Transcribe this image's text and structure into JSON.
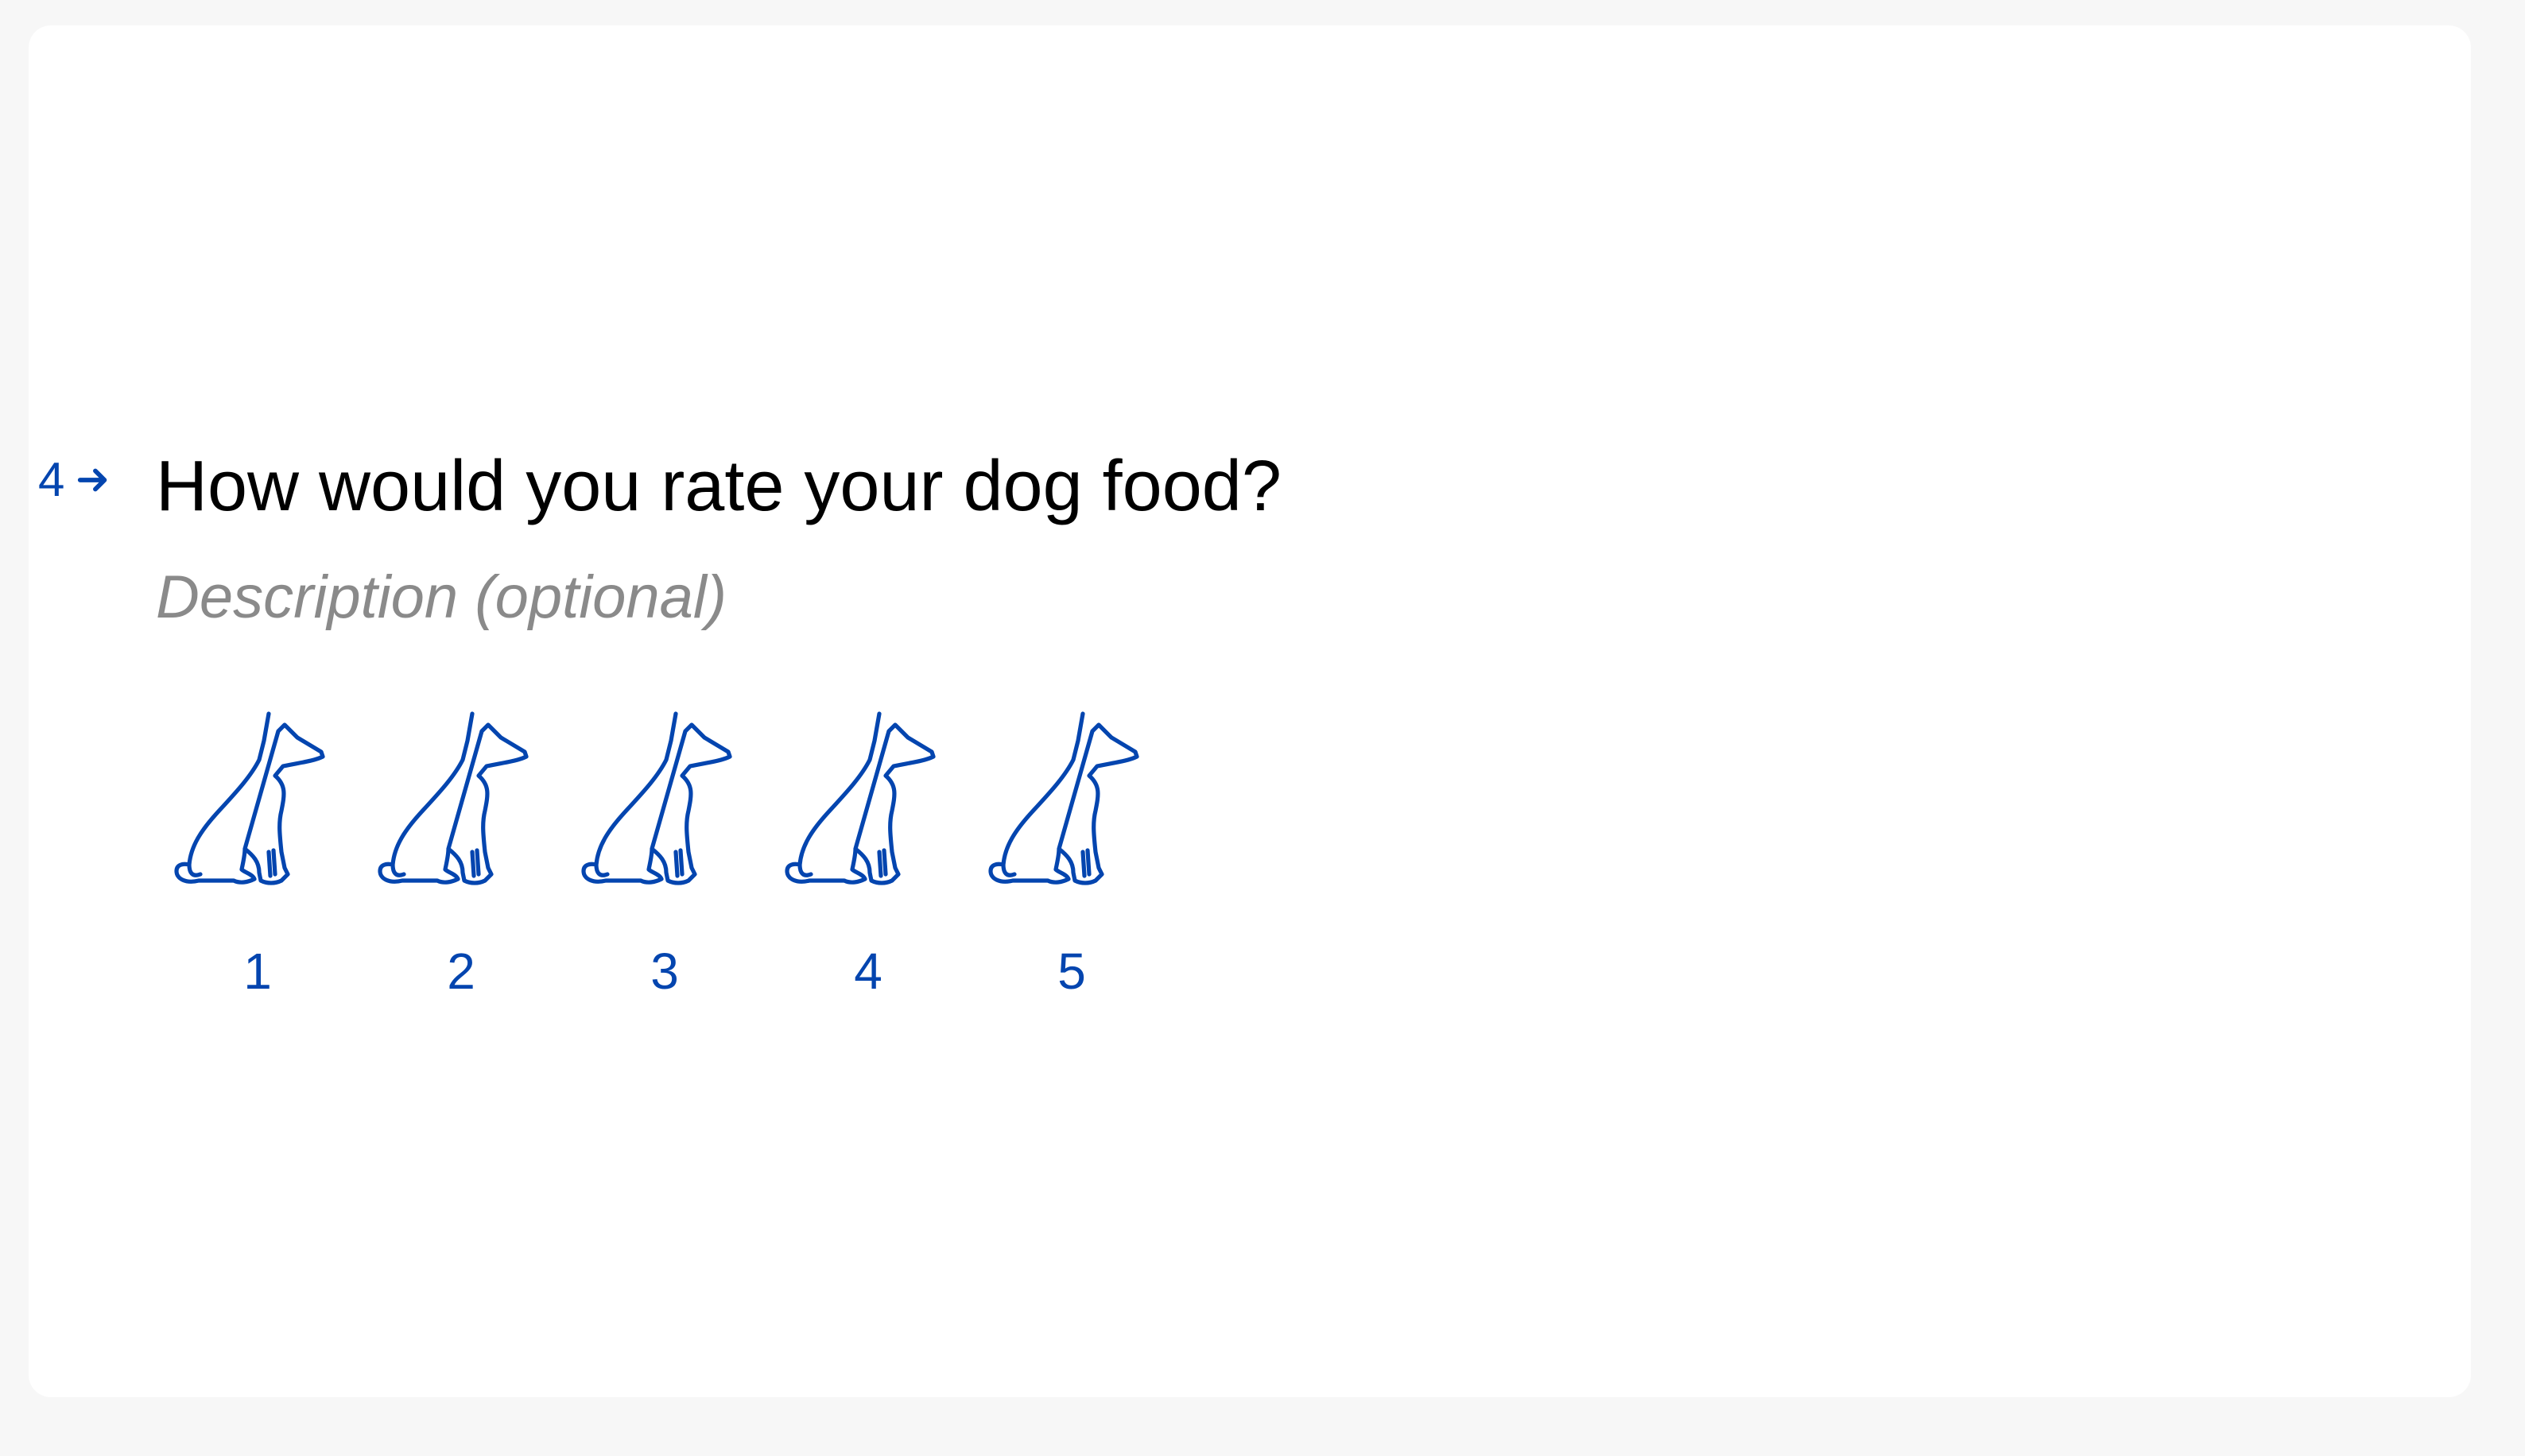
{
  "question": {
    "number": "4",
    "title": "How would you rate your dog food?",
    "description_placeholder": "Description (optional)"
  },
  "rating": {
    "icon": "dog-icon",
    "options": [
      {
        "label": "1"
      },
      {
        "label": "2"
      },
      {
        "label": "3"
      },
      {
        "label": "4"
      },
      {
        "label": "5"
      }
    ]
  },
  "colors": {
    "accent": "#0445af",
    "title": "#000000",
    "description": "#8a8a8a",
    "page_background": "#f7f7f7",
    "card_background": "#ffffff"
  }
}
